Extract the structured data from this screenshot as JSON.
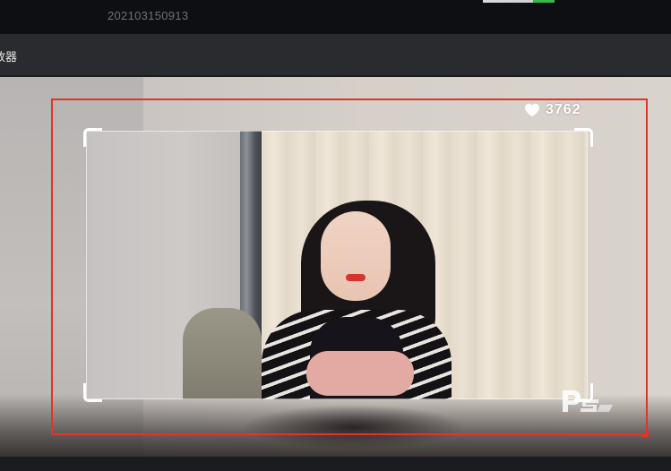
{
  "topbar": {
    "timestamp": "202103150913"
  },
  "subbar": {
    "label": "放器"
  },
  "overlay": {
    "likes_count": "3762",
    "like_icon": "heart-icon",
    "watermark_icon": "ps-watermark-icon"
  },
  "colors": {
    "selection_border": "#e53326",
    "bracket": "#ffffff"
  }
}
